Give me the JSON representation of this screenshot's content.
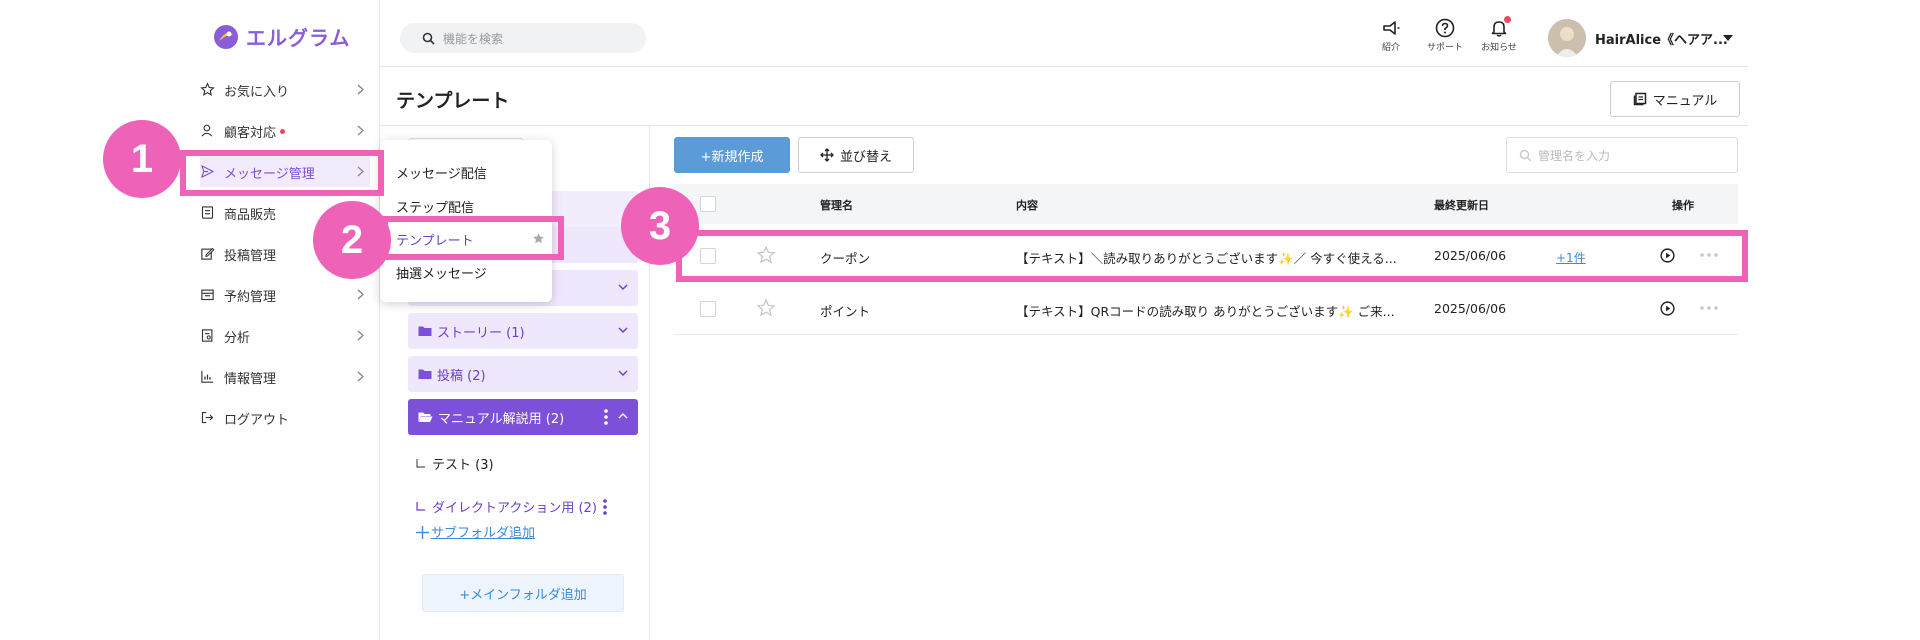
{
  "app": {
    "logo_text": "エルグラム"
  },
  "search": {
    "placeholder": "機能を検索"
  },
  "topbar": {
    "icons": [
      {
        "name": "megaphone-icon",
        "label": "紹介"
      },
      {
        "name": "help-icon",
        "label": "サポート"
      },
      {
        "name": "bell-icon",
        "label": "お知らせ"
      }
    ],
    "user_name": "HairAlice《ヘアア..."
  },
  "sidebar": {
    "items": [
      {
        "label": "お気に入り",
        "icon": "star-icon",
        "has_chevron": true
      },
      {
        "label": "顧客対応",
        "icon": "person-icon",
        "has_chevron": true,
        "dot": true
      },
      {
        "label": "メッセージ管理",
        "icon": "send-icon",
        "has_chevron": true,
        "active": true
      },
      {
        "label": "商品販売",
        "icon": "register-icon",
        "has_chevron": false
      },
      {
        "label": "投稿管理",
        "icon": "edit-icon",
        "has_chevron": false
      },
      {
        "label": "予約管理",
        "icon": "calendar-icon",
        "has_chevron": true
      },
      {
        "label": "分析",
        "icon": "report-icon",
        "has_chevron": true
      },
      {
        "label": "情報管理",
        "icon": "chart-icon",
        "has_chevron": true
      },
      {
        "label": "ログアウト",
        "icon": "logout-icon",
        "has_chevron": false
      }
    ]
  },
  "submenu": {
    "items": [
      "メッセージ配信",
      "ステップ配信",
      "テンプレート",
      "抽選メッセージ"
    ]
  },
  "page": {
    "title": "テンプレート",
    "manual_label": "マニュアル"
  },
  "folders": {
    "items": [
      {
        "label": "ストーリー (1)"
      },
      {
        "label": "投稿 (2)"
      },
      {
        "label": "マニュアル解説用 (2)",
        "active": true
      }
    ],
    "subfolders": [
      {
        "label": "テスト (3)"
      },
      {
        "label": "ダイレクトアクション用 (2)"
      }
    ],
    "add_sub_label": "サブフォルダ追加",
    "add_main_label": "+メインフォルダ追加"
  },
  "toolbar": {
    "new_label": "+新規作成",
    "sort_label": "並び替え",
    "name_search_placeholder": "管理名を入力"
  },
  "table": {
    "headers": [
      "管理名",
      "内容",
      "最終更新日",
      "操作"
    ],
    "rows": [
      {
        "name": "クーポン",
        "content": "【テキスト】＼読み取りありがとうございます✨／ 今すぐ使える...",
        "date": "2025/06/06",
        "extra": "+1件"
      },
      {
        "name": "ポイント",
        "content": "【テキスト】QRコードの読み取り ありがとうございます✨ ご来...",
        "date": "2025/06/06",
        "extra": ""
      }
    ]
  },
  "annotations": {
    "badges": [
      "1",
      "2",
      "3"
    ]
  },
  "colors": {
    "accent": "#7c50d8",
    "highlight": "#ee63b8",
    "primary_button": "#5b9bd8"
  }
}
